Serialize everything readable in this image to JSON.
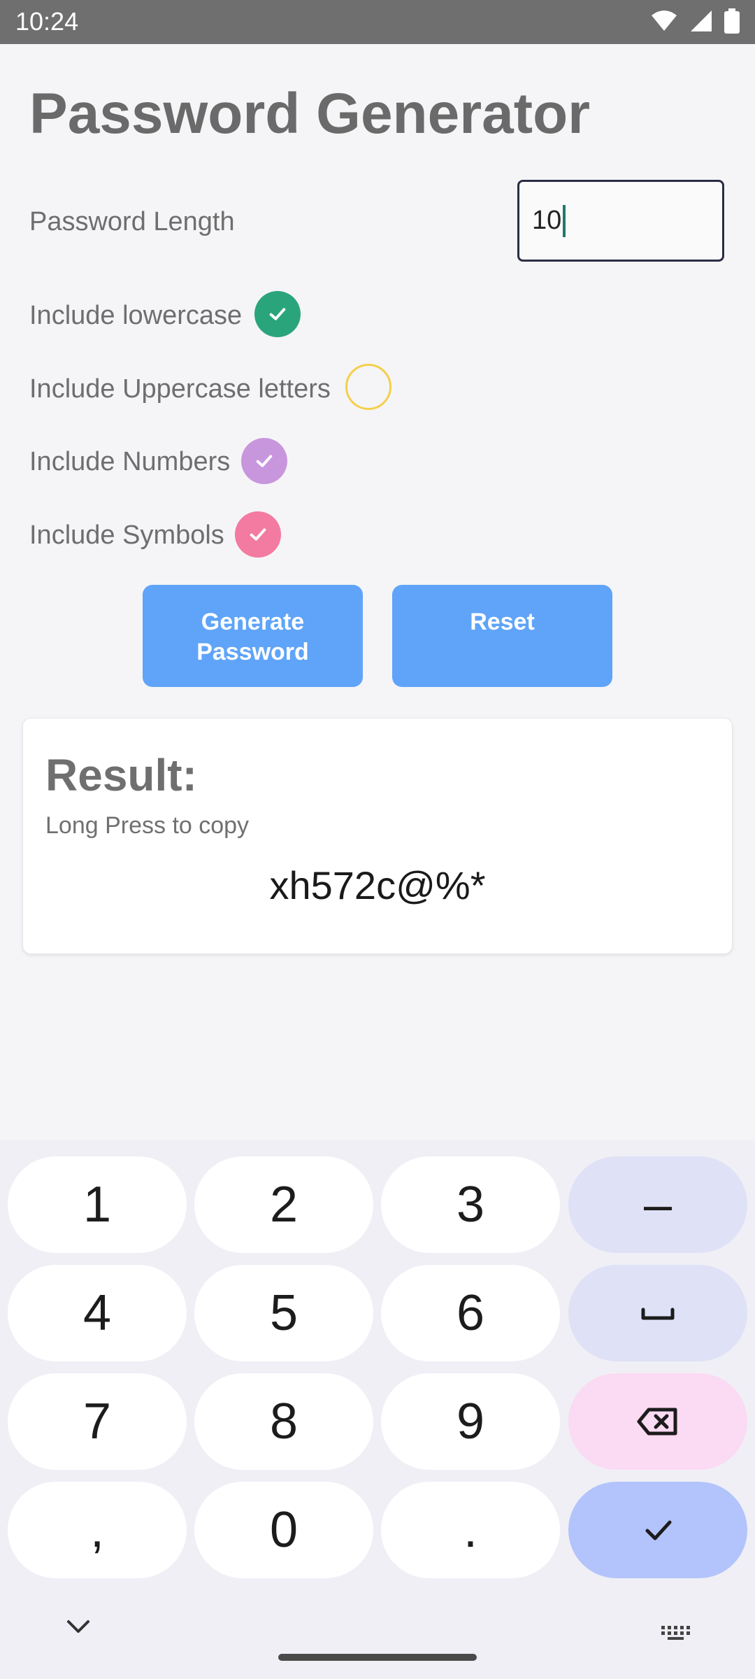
{
  "status": {
    "time": "10:24"
  },
  "app": {
    "title": "Password Generator"
  },
  "form": {
    "length_label": "Password Length",
    "length_value": "10",
    "options": [
      {
        "label": "Include lowercase",
        "checked": true,
        "color": "#2aa57b"
      },
      {
        "label": "Include Uppercase letters",
        "checked": false,
        "color": "#f3d04a"
      },
      {
        "label": "Include Numbers",
        "checked": true,
        "color": "#c896dc"
      },
      {
        "label": "Include Symbols",
        "checked": true,
        "color": "#f37aa0"
      }
    ]
  },
  "buttons": {
    "generate_line1": "Generate",
    "generate_line2": "Password",
    "reset": "Reset"
  },
  "result": {
    "title": "Result:",
    "hint": "Long Press to copy",
    "password": "xh572c@%*"
  },
  "keyboard": {
    "keys": [
      "1",
      "2",
      "3",
      "–",
      "4",
      "5",
      "6",
      "space",
      "7",
      "8",
      "9",
      "backspace",
      ",",
      "0",
      ".",
      "done"
    ]
  },
  "colors": {
    "accent": "#5fa4f8",
    "card": "#ffffff",
    "background": "#f5f5f8"
  }
}
